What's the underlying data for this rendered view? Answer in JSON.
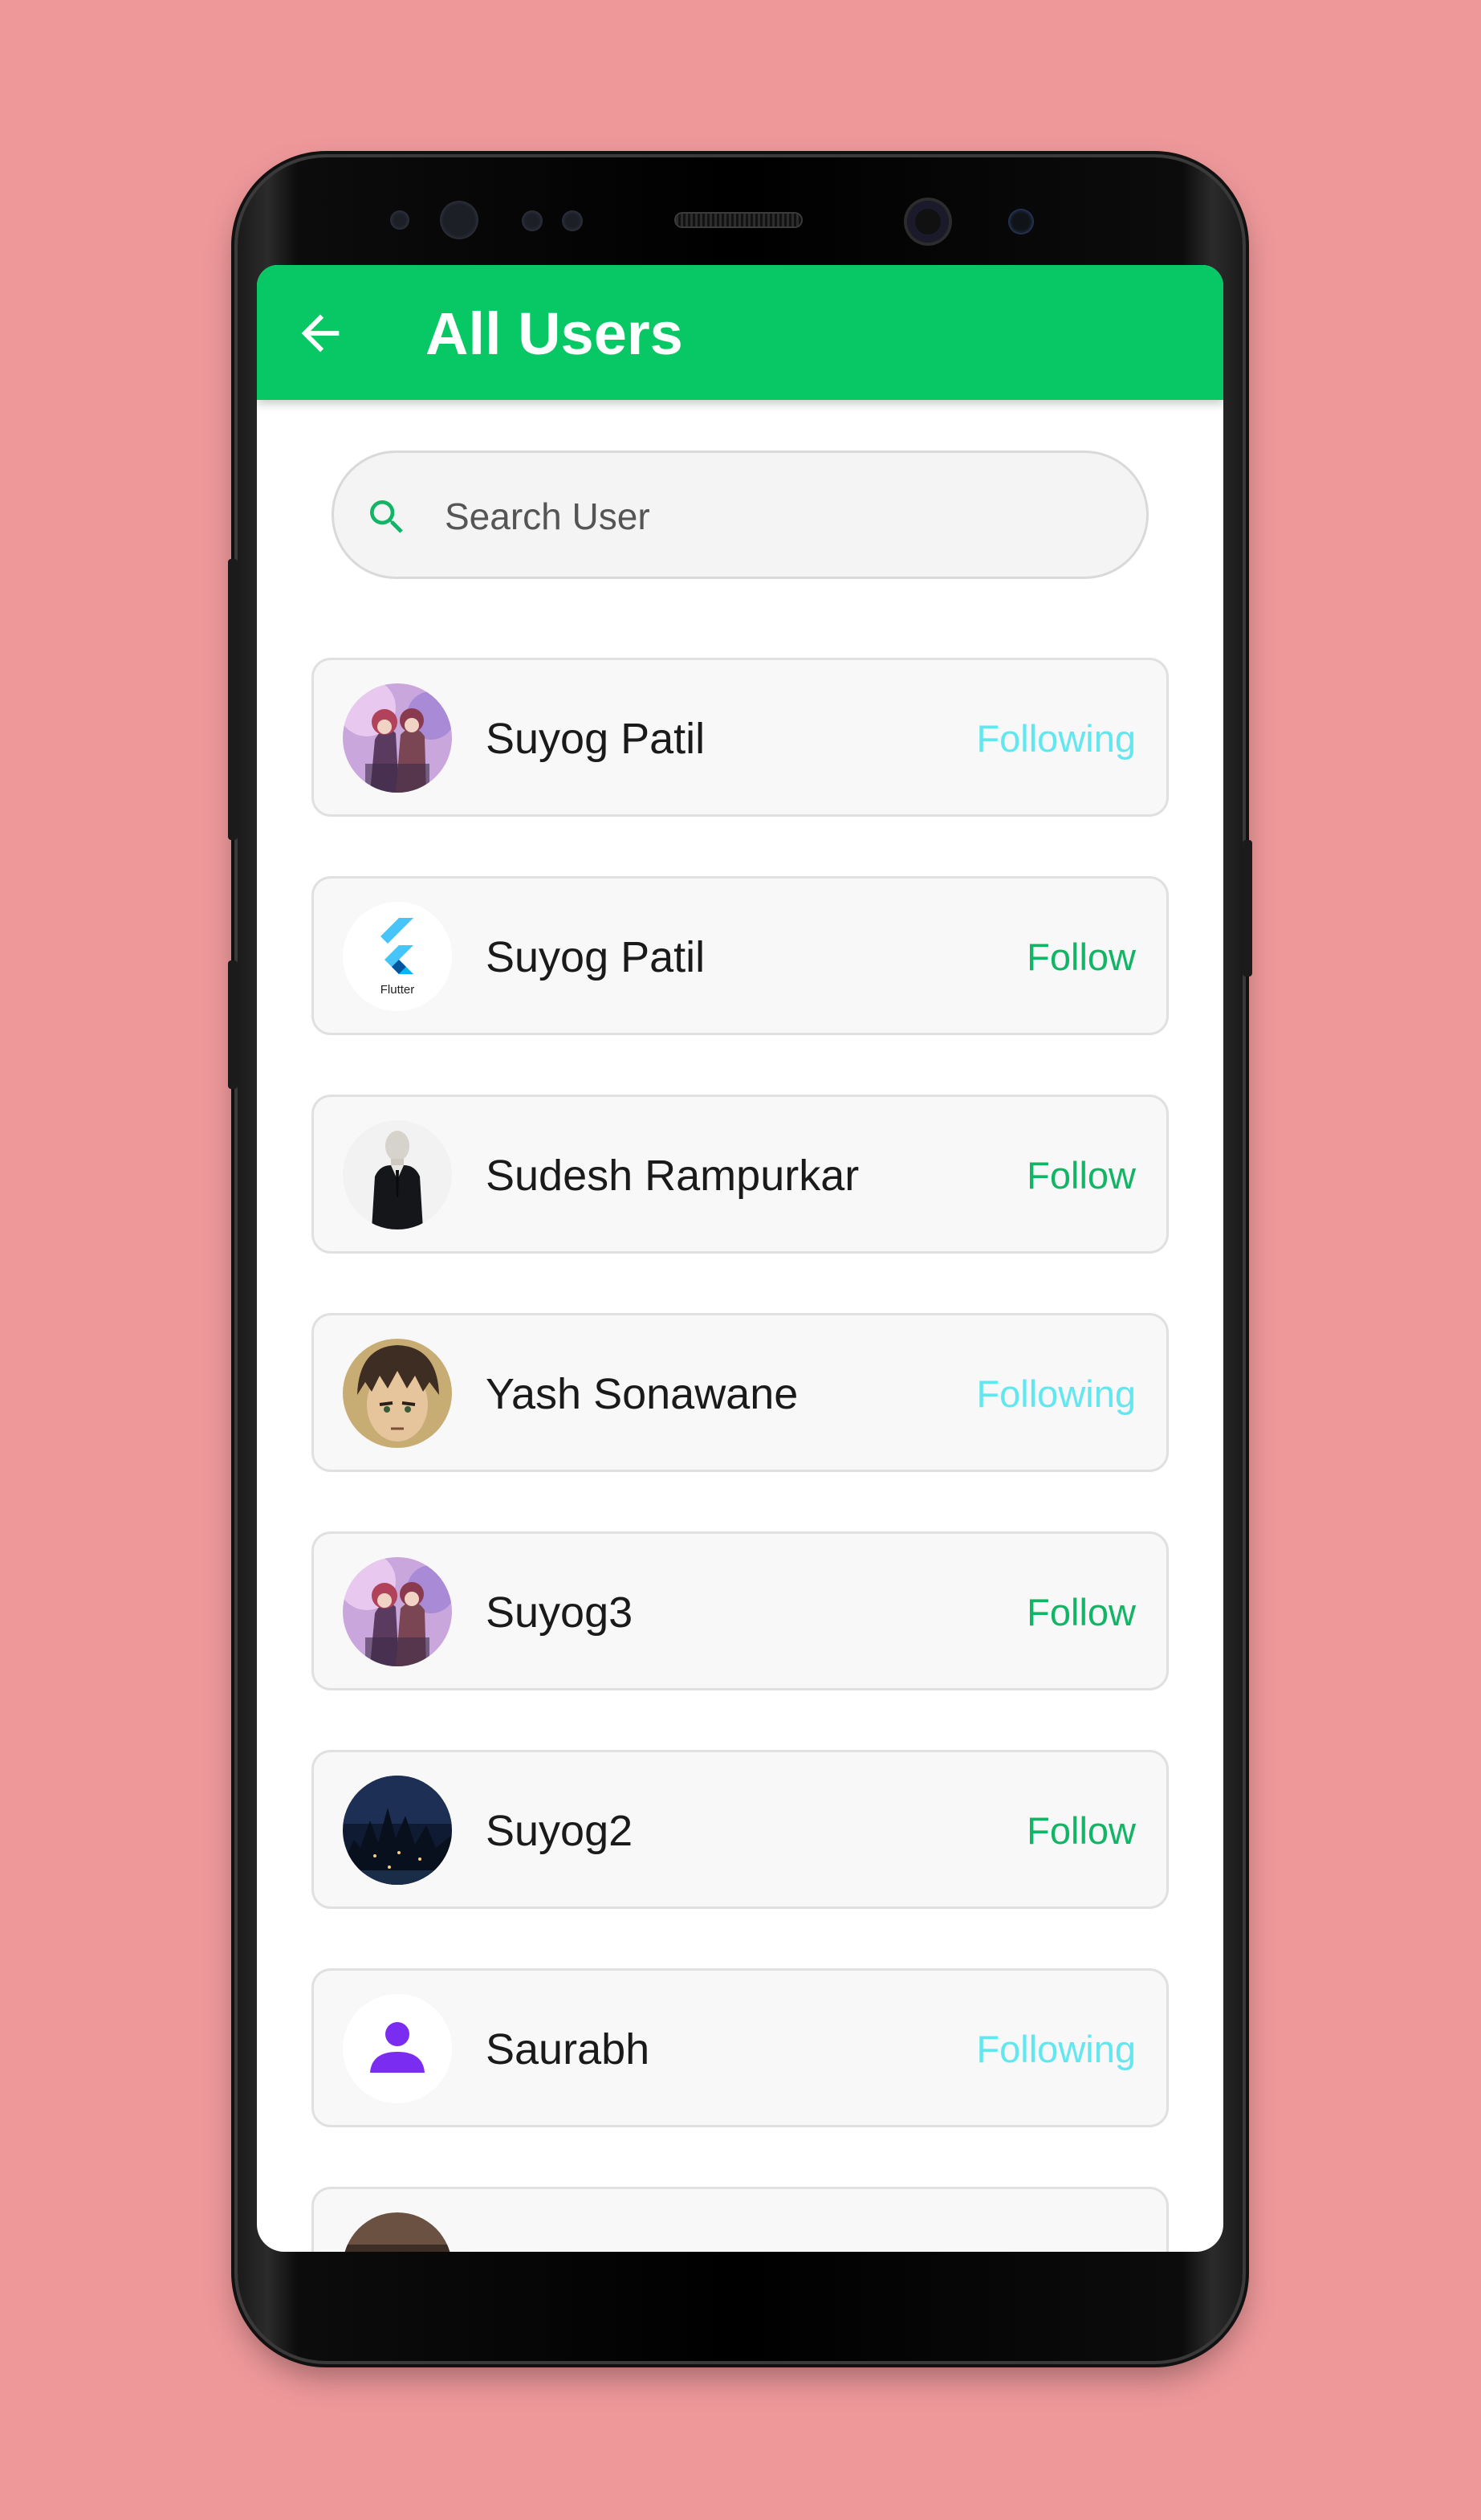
{
  "app_bar": {
    "title": "All Users",
    "back_icon": "arrow-left-icon"
  },
  "search": {
    "placeholder": "Search User",
    "value": "",
    "icon": "search-icon"
  },
  "colors": {
    "background": "#ee989a",
    "primary": "#08c866",
    "follow": "#12b566",
    "following": "#62e6ef"
  },
  "users": [
    {
      "name": "Suyog Patil",
      "action": "Following",
      "avatar": "anime-duo-avatar"
    },
    {
      "name": "Suyog Patil",
      "action": "Follow",
      "avatar": "flutter-logo-avatar",
      "avatar_text": "Flutter"
    },
    {
      "name": "Sudesh Rampurkar",
      "action": "Follow",
      "avatar": "man-in-suit-avatar"
    },
    {
      "name": "Yash Sonawane",
      "action": "Following",
      "avatar": "anime-boy-avatar"
    },
    {
      "name": "Suyog3",
      "action": "Follow",
      "avatar": "anime-duo-avatar"
    },
    {
      "name": "Suyog2",
      "action": "Follow",
      "avatar": "night-castle-avatar"
    },
    {
      "name": "Saurabh",
      "action": "Following",
      "avatar": "default-person-avatar"
    }
  ]
}
